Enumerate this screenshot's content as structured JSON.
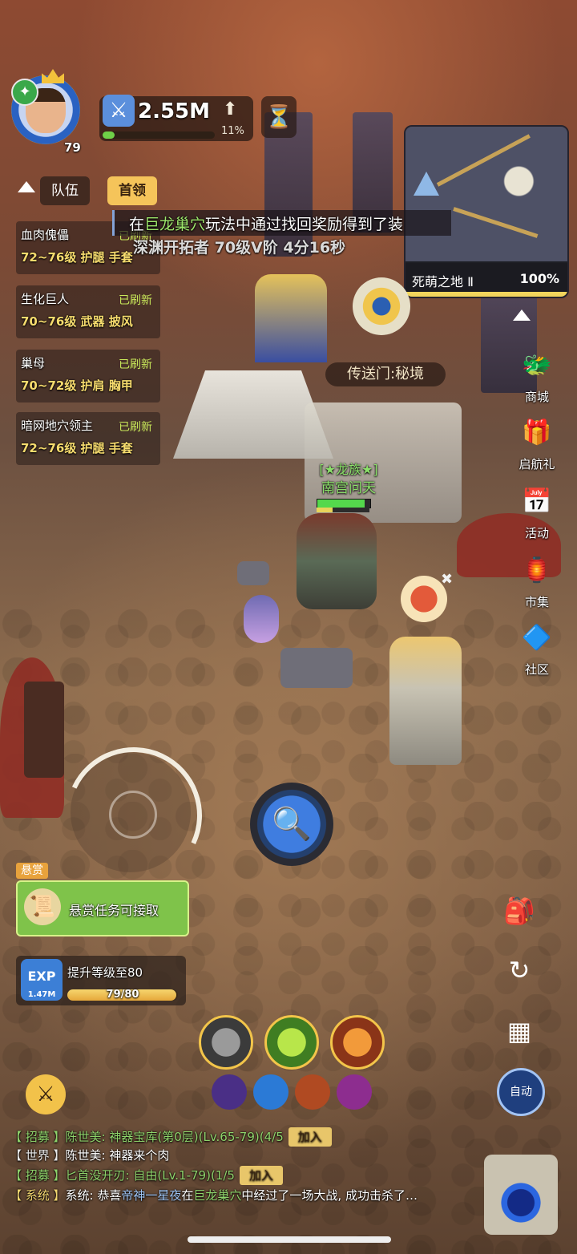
{
  "header": {
    "level": "79",
    "power": "2.55M",
    "power_pct": "11%",
    "xp_fraction": 0.11
  },
  "tabs": {
    "team": "队伍",
    "boss": "首领"
  },
  "bosses": [
    {
      "name": "血肉傀儡",
      "status": "已刷新",
      "info": "72~76级 护腿 手套"
    },
    {
      "name": "生化巨人",
      "status": "已刷新",
      "info": "70~76级 武器 披风"
    },
    {
      "name": "巢母",
      "status": "已刷新",
      "info": "70~72级 护肩 胸甲"
    },
    {
      "name": "暗网地穴领主",
      "status": "已刷新",
      "info": "72~76级 护腿 手套"
    }
  ],
  "announcement": {
    "prefix": "在",
    "highlight": "巨龙巢穴",
    "suffix": "玩法中通过找回奖励得到了装",
    "sub": "深渊开拓者 70级V阶 4分16秒"
  },
  "minimap": {
    "name": "死萌之地 Ⅱ",
    "progress": "100%",
    "progress_value": 1.0
  },
  "portal": {
    "label": "传送门:秘境"
  },
  "side_menu": [
    {
      "label": "商城",
      "icon": "dragon-icon",
      "glyph": "🐲"
    },
    {
      "label": "启航礼",
      "icon": "gift-icon",
      "glyph": "🎁"
    },
    {
      "label": "活动",
      "icon": "calendar-icon",
      "glyph": "📅"
    },
    {
      "label": "市集",
      "icon": "market-icon",
      "glyph": "🏮"
    },
    {
      "label": "社区",
      "icon": "community-icon",
      "glyph": "🔷"
    }
  ],
  "player": {
    "tag": "[★龙族★]",
    "name": "南宫问天",
    "hp_fraction": 0.9,
    "mp_fraction": 0.3
  },
  "quests": {
    "bounty_tag": "悬赏",
    "bounty_text": "悬赏任务可接取",
    "exp_label": "EXP",
    "exp_amount": "1.47M",
    "level_text": "提升等级至80",
    "level_progress": "79/80",
    "level_fraction": 0.9875
  },
  "auto_label": "自动",
  "chat": [
    {
      "channel": "【 招募 】",
      "text": "陈世美: 神器宝库(第0层)(Lv.65-79)(4/5",
      "join": "加入"
    },
    {
      "channel": "【 世界 】",
      "text": "陈世美: 神器来个肉"
    },
    {
      "channel": "【 招募 】",
      "text": "匕首没开刃: 自由(Lv.1-79)(1/5",
      "join": "加入"
    },
    {
      "channel": "【 系统 】",
      "text_pre": "系统: 恭喜",
      "name": "帝神一星夜",
      "text_mid": "在",
      "place": "巨龙巢穴",
      "text_post": "中经过了一场大战, 成功击杀了…"
    }
  ],
  "colors": {
    "accent": "#f5c45a",
    "green": "#8ed36b",
    "hp": "#54d84c"
  }
}
